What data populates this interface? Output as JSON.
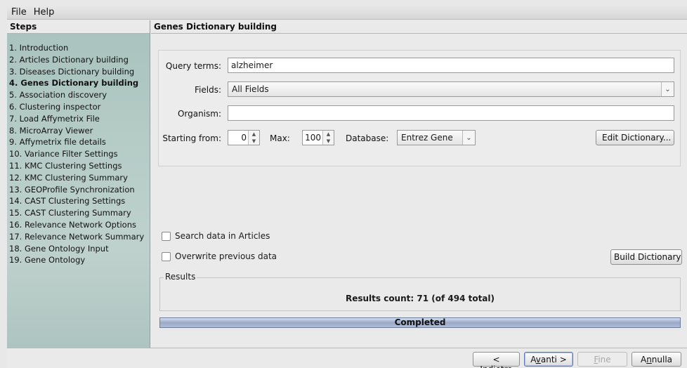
{
  "menu": [
    "File",
    "Help"
  ],
  "sidebar": {
    "title": "Steps",
    "active_index": 3,
    "steps": [
      "1. Introduction",
      "2. Articles Dictionary building",
      "3. Diseases Dictionary building",
      "4. Genes Dictionary building",
      "5. Association discovery",
      "6. Clustering inspector",
      "7. Load Affymetrix File",
      "8. MicroArray Viewer",
      "9. Affymetrix file details",
      "10. Variance Filter Settings",
      "11. KMC Clustering Settings",
      "12. KMC Clustering Summary",
      "13. GEOProfile Synchronization",
      "14. CAST Clustering Settings",
      "15. CAST Clustering Summary",
      "16. Relevance Network Options",
      "17. Relevance Network Summary",
      "18. Gene Ontology Input",
      "19. Gene Ontology"
    ]
  },
  "main": {
    "title": "Genes Dictionary building",
    "form": {
      "query_label": "Query terms:",
      "query_value": "alzheimer",
      "fields_label": "Fields:",
      "fields_value": "All Fields",
      "organism_label": "Organism:",
      "organism_value": "",
      "starting_label": "Starting from:",
      "starting_value": "0",
      "max_label": "Max:",
      "max_value": "100",
      "database_label": "Database:",
      "database_value": "Entrez Gene",
      "edit_button": "Edit Dictionary..."
    },
    "options": {
      "search_articles": "Search data in Articles",
      "overwrite": "Overwrite previous data",
      "build_button": "Build Dictionary"
    },
    "results": {
      "title": "Results",
      "text": "Results count: 71 (of 494 total)"
    },
    "progress": {
      "text": "Completed",
      "fraction": 1.0
    }
  },
  "footer": {
    "back_prefix": "< ",
    "back_mnemonic": "I",
    "back_rest": "ndietro",
    "next_prefix": "A",
    "next_mnemonic": "v",
    "next_rest": "anti >",
    "finish_mnemonic": "F",
    "finish_rest": "ine",
    "cancel_prefix": "A",
    "cancel_mnemonic": "n",
    "cancel_rest": "nulla"
  }
}
